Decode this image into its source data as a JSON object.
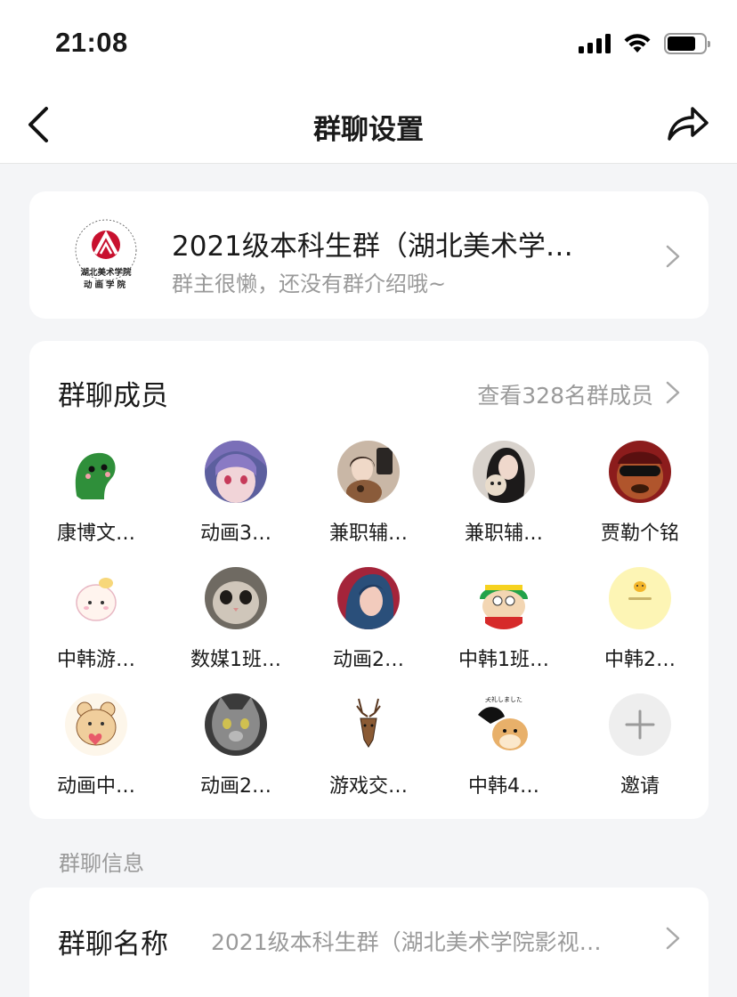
{
  "status": {
    "time": "21:08"
  },
  "nav": {
    "title": "群聊设置"
  },
  "group": {
    "name": "2021级本科生群（湖北美术学…",
    "description": "群主很懒，还没有群介绍哦~",
    "logo_text_line1": "湖北美术学院",
    "logo_text_line2": "动画学院"
  },
  "members": {
    "title": "群聊成员",
    "view_all": "查看328名群成员",
    "list": [
      {
        "name": "康博文…",
        "icon": "green-dino-avatar"
      },
      {
        "name": "动画3…",
        "icon": "anime-girl-avatar"
      },
      {
        "name": "兼职辅…",
        "icon": "photo-avatar"
      },
      {
        "name": "兼职辅…",
        "icon": "photo-avatar"
      },
      {
        "name": "贾勒个铭",
        "icon": "cartoon-face-avatar"
      },
      {
        "name": "中韩游…",
        "icon": "cute-bunny-avatar"
      },
      {
        "name": "数媒1班…",
        "icon": "cat-avatar"
      },
      {
        "name": "动画2…",
        "icon": "anime-girl-avatar"
      },
      {
        "name": "中韩1班…",
        "icon": "cartman-avatar"
      },
      {
        "name": "中韩2…",
        "icon": "yellow-chick-avatar"
      },
      {
        "name": "动画中…",
        "icon": "teddy-bear-avatar"
      },
      {
        "name": "动画2…",
        "icon": "gray-cat-avatar"
      },
      {
        "name": "游戏交…",
        "icon": "deer-avatar"
      },
      {
        "name": "中韩4…",
        "icon": "doge-avatar"
      }
    ],
    "invite_label": "邀请",
    "doge_caption": "失礼しました"
  },
  "info": {
    "section_label": "群聊信息",
    "name_label": "群聊名称",
    "name_value": "2021级本科生群（湖北美术学院影视…"
  },
  "colors": {
    "accent_red": "#c8102e",
    "bg": "#f4f5f7",
    "card": "#ffffff",
    "secondary_text": "#9a9a9a"
  }
}
